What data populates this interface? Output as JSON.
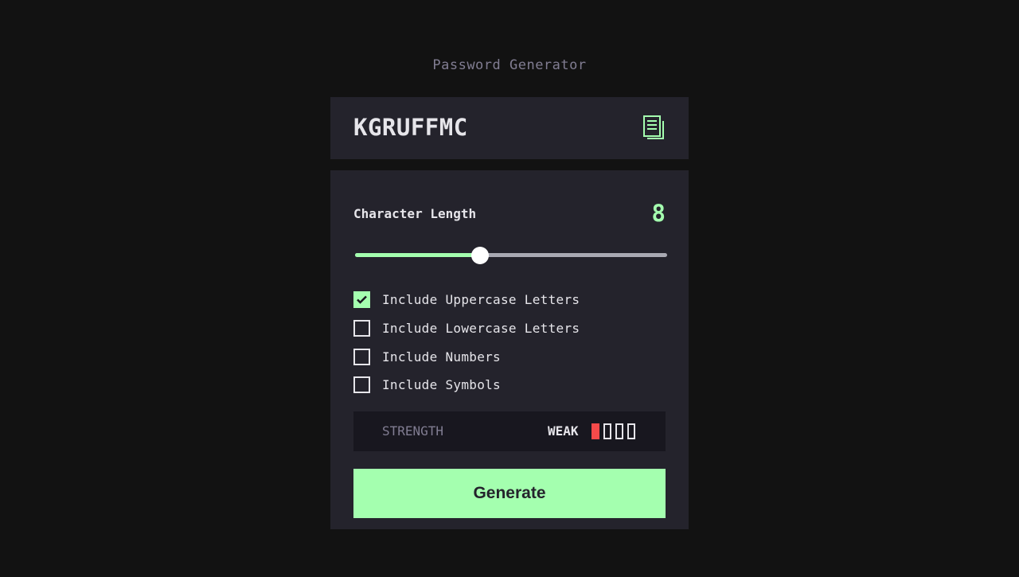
{
  "app": {
    "title": "Password Generator"
  },
  "output": {
    "password": "KGRUFFMC",
    "copy_icon": "copy-icon"
  },
  "settings": {
    "length_label": "Character Length",
    "length_value": "8",
    "slider": {
      "min": 0,
      "max": 20,
      "value": 8
    },
    "options": [
      {
        "label": "Include Uppercase Letters",
        "checked": true
      },
      {
        "label": "Include Lowercase Letters",
        "checked": false
      },
      {
        "label": "Include Numbers",
        "checked": false
      },
      {
        "label": "Include Symbols",
        "checked": false
      }
    ]
  },
  "strength": {
    "label": "STRENGTH",
    "value": "WEAK",
    "filled_bars": 1,
    "total_bars": 4,
    "color": "#F64A4A"
  },
  "generate_button": {
    "label": "Generate"
  },
  "colors": {
    "background": "#121212",
    "panel": "#24232C",
    "accent": "#A4FFAF",
    "weak": "#F64A4A"
  }
}
